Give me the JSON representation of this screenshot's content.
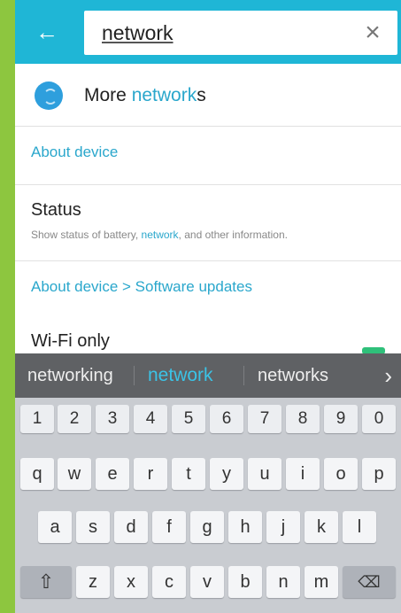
{
  "search": {
    "query": "network"
  },
  "results": {
    "more_networks": {
      "prefix": "More ",
      "match": "network",
      "suffix": "s"
    },
    "section_about": "About device",
    "status": {
      "title": "Status",
      "sub_prefix": "Show status of battery, ",
      "sub_match": "network",
      "sub_suffix": ", and other information."
    },
    "section_software": "About device > Software updates",
    "wifi_only": "Wi-Fi only"
  },
  "suggestions": [
    "networking",
    "network",
    "networks"
  ],
  "keyboard": {
    "numbers": [
      "1",
      "2",
      "3",
      "4",
      "5",
      "6",
      "7",
      "8",
      "9",
      "0"
    ],
    "row1": [
      "q",
      "w",
      "e",
      "r",
      "t",
      "y",
      "u",
      "i",
      "o",
      "p"
    ],
    "row2": [
      "a",
      "s",
      "d",
      "f",
      "g",
      "h",
      "j",
      "k",
      "l"
    ],
    "row3": [
      "z",
      "x",
      "c",
      "v",
      "b",
      "n",
      "m"
    ]
  },
  "icons": {
    "back": "back-arrow-icon",
    "clear": "close-icon",
    "more": "chevron-right-icon",
    "shift": "shift-icon",
    "backspace": "backspace-icon",
    "wifi": "wifi-icon"
  },
  "colors": {
    "header": "#1fb6d6",
    "accent": "#2aa7cc",
    "frame": "#8dc63f",
    "suggestion_bar": "#5f6164"
  }
}
